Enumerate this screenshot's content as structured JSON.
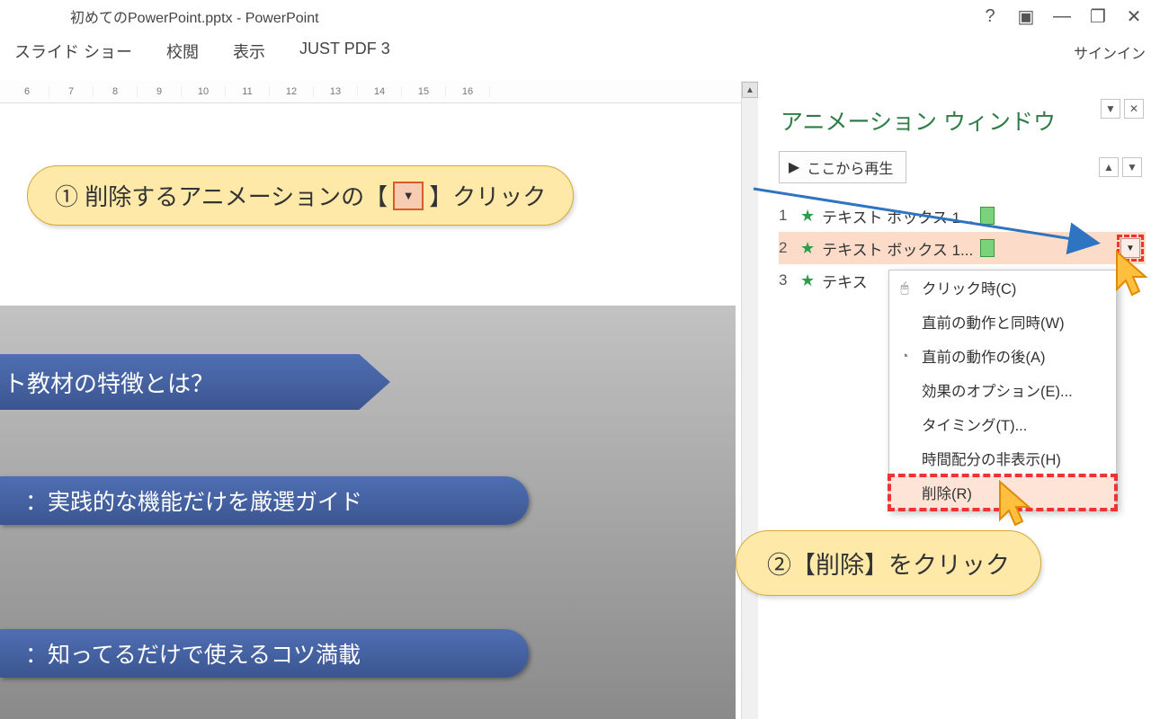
{
  "titlebar": {
    "title": "初めてのPowerPoint.pptx - PowerPoint",
    "help": "?",
    "ribbon_opts": "▣",
    "minimize": "—",
    "restore": "❐",
    "close": "✕"
  },
  "ribbon": {
    "tabs": [
      "スライド ショー",
      "校閲",
      "表示",
      "JUST PDF 3"
    ],
    "signin": "サインイン"
  },
  "ruler": [
    "6",
    "7",
    "8",
    "9",
    "10",
    "11",
    "12",
    "13",
    "14",
    "15",
    "16"
  ],
  "slide": {
    "title": "ト教材の特徴とは？",
    "line1": "：実践的な機能だけを厳選ガイド",
    "line2": "：知ってるだけで使えるコツ満載"
  },
  "anim_pane": {
    "title": "アニメーション ウィンドウ",
    "pane_menu": "▼",
    "pane_close": "✕",
    "play": "ここから再生",
    "up": "▲",
    "down": "▼",
    "items": [
      {
        "num": "1",
        "label": "テキスト ボックス 1..."
      },
      {
        "num": "2",
        "label": "テキスト ボックス 1..."
      },
      {
        "num": "3",
        "label": "テキス"
      }
    ],
    "drop": "▼"
  },
  "ctx_menu": {
    "click_on": "クリック時(C)",
    "with_prev": "直前の動作と同時(W)",
    "after_prev": "直前の動作の後(A)",
    "effect_opts": "効果のオプション(E)...",
    "timing": "タイミング(T)...",
    "hide_timeline": "時間配分の非表示(H)",
    "delete": "削除(R)",
    "icon_mouse": "🖱",
    "icon_clock": "◔"
  },
  "callouts": {
    "c1_pre": "① 削除するアニメーションの【",
    "c1_post": "】クリック",
    "c1_drop": "▼",
    "c2": "②【削除】をクリック"
  }
}
